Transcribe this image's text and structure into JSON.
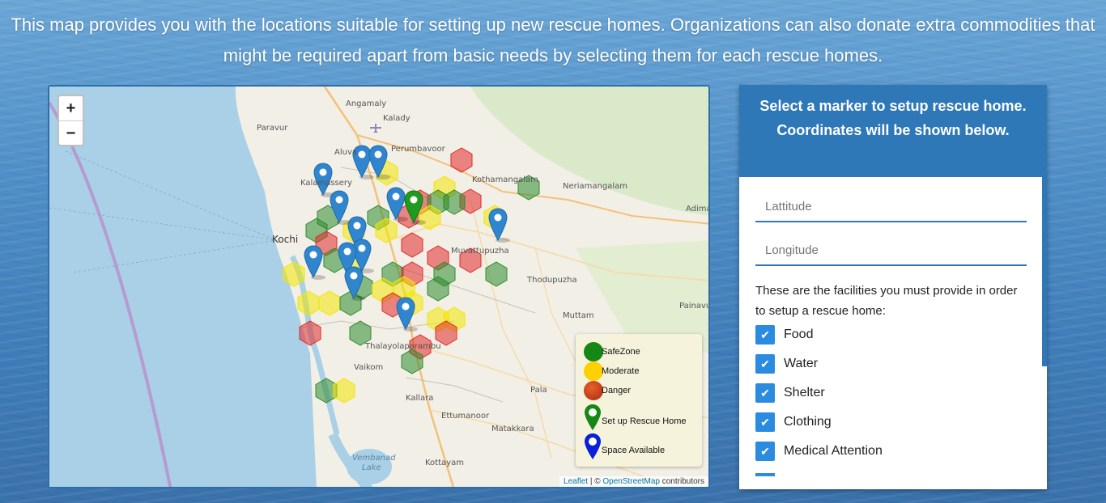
{
  "intro_text": "This map provides you with the locations suitable for setting up new rescue homes. Organizations can also donate extra commodities that might be required apart from basic needs by selecting them for each rescue homes.",
  "map": {
    "zoom_in": "+",
    "zoom_out": "−",
    "places": {
      "angamaly": "Angamaly",
      "kalady": "Kalady",
      "paravur": "Paravur",
      "aluva": "Aluva",
      "perumbavoor": "Perumbavoor",
      "kothamangalam": "Kothamangalam",
      "neriamangalam": "Neriamangalam",
      "adimali": "Adima",
      "kalamassery": "Kalamassery",
      "kochi": "Kochi",
      "muvattupuzha": "Muvattupuzha",
      "thodupuzha": "Thodupuzha",
      "painavu": "Painavu",
      "muttam": "Muttam",
      "thalayolaparambu": "Thalayolaparambu",
      "vaikom": "Vaikom",
      "pala": "Pala",
      "kallara": "Kallara",
      "ettumanoor": "Ettumanoor",
      "matakkara": "Matakkara",
      "vembanad": "Vembanad",
      "lake": "Lake",
      "kottayam": "Kottayam"
    },
    "legend": {
      "safezone": "SafeZone",
      "moderate": "Moderate",
      "danger": "Danger",
      "setup": "Set up Rescue Home",
      "space": "Space Available"
    },
    "attribution": {
      "leaflet": "Leaflet",
      "sep": " | © ",
      "osm": "OpenStreetMap",
      "suffix": " contributors"
    },
    "colors": {
      "safe": "#2e8b2e",
      "moderate": "#f2e600",
      "danger": "#e02a2a",
      "marker_blue": "#2f86cf",
      "marker_green": "#1f9c1f"
    }
  },
  "panel": {
    "header": "Select a marker to setup rescue home. Coordinates will be shown below.",
    "latitude_placeholder": "Lattitude",
    "longitude_placeholder": "Longitude",
    "facilities_note": "These are the facilities you must provide in order to setup a rescue home:",
    "facilities": [
      "Food",
      "Water",
      "Shelter",
      "Clothing",
      "Medical Attention"
    ]
  }
}
